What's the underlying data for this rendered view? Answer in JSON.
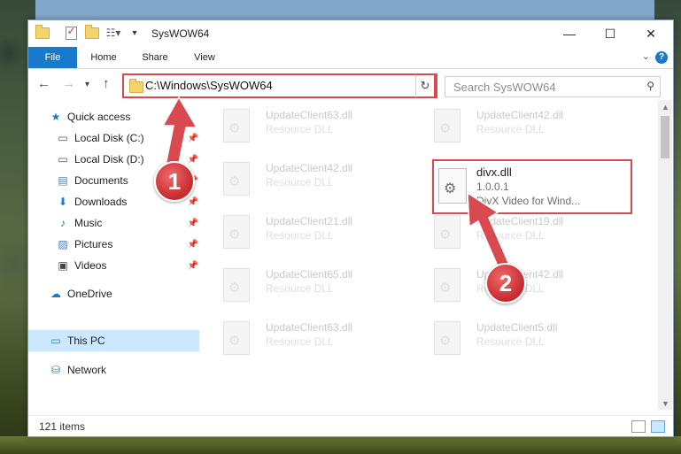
{
  "window": {
    "title": "SysWOW64",
    "controls": {
      "minimize": "—",
      "maximize": "☐",
      "close": "✕"
    }
  },
  "ribbon": {
    "tabs": [
      "File",
      "Home",
      "Share",
      "View"
    ]
  },
  "nav": {
    "address": "C:\\Windows\\SysWOW64",
    "search_placeholder": "Search SysWOW64"
  },
  "sidebar": {
    "items": [
      {
        "label": "Quick access",
        "icon": "star-icon",
        "pinned": false
      },
      {
        "label": "Local Disk (C:)",
        "icon": "drive-icon",
        "pinned": true
      },
      {
        "label": "Local Disk (D:)",
        "icon": "drive-icon",
        "pinned": true
      },
      {
        "label": "Documents",
        "icon": "document-icon",
        "pinned": true
      },
      {
        "label": "Downloads",
        "icon": "download-icon",
        "pinned": true
      },
      {
        "label": "Music",
        "icon": "music-icon",
        "pinned": true
      },
      {
        "label": "Pictures",
        "icon": "pictures-icon",
        "pinned": true
      },
      {
        "label": "Videos",
        "icon": "videos-icon",
        "pinned": true
      },
      {
        "label": "OneDrive",
        "icon": "cloud-icon",
        "pinned": false
      },
      {
        "label": "This PC",
        "icon": "computer-icon",
        "pinned": false,
        "selected": true
      },
      {
        "label": "Network",
        "icon": "network-icon",
        "pinned": false
      }
    ]
  },
  "files": {
    "left": [
      {
        "name": "UpdateClient63.dll",
        "type": "Resource DLL"
      },
      {
        "name": "UpdateClient42.dll",
        "type": "Resource DLL"
      },
      {
        "name": "UpdateClient21.dll",
        "type": "Resource DLL"
      },
      {
        "name": "UpdateClient65.dll",
        "type": "Resource DLL"
      },
      {
        "name": "UpdateClient63.dll",
        "type": "Resource DLL"
      }
    ],
    "right": [
      {
        "name": "UpdateClient42.dll",
        "type": "Resource DLL"
      },
      {
        "name": "UpdateClient19.dll",
        "type": "Resource DLL"
      },
      {
        "name": "UpdateClient42.dll",
        "type": "Resource DLL"
      },
      {
        "name": "UpdateClient5.dll",
        "type": "Resource DLL"
      }
    ],
    "highlighted": {
      "name": "divx.dll",
      "version": "1.0.0.1",
      "description": "DivX Video for Wind..."
    }
  },
  "status": {
    "item_count": "121 items"
  },
  "annotations": {
    "step1": "1",
    "step2": "2"
  },
  "colors": {
    "accent": "#1979ca",
    "highlight_border": "#d84a4f",
    "selection": "#cce8ff"
  }
}
